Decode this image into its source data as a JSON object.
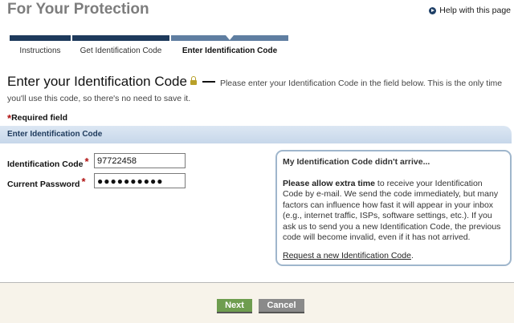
{
  "page": {
    "title": "For Your Protection",
    "help_link": "Help with this page"
  },
  "steps": [
    {
      "label": "Instructions",
      "active": false
    },
    {
      "label": "Get Identification Code",
      "active": false
    },
    {
      "label": "Enter Identification Code",
      "active": true
    }
  ],
  "heading": {
    "title": "Enter your Identification Code",
    "description": "Please enter your Identification Code in the field below. This is the only time you'll use this code, so there's no need to save it."
  },
  "required_note": "Required field",
  "section": {
    "title": "Enter Identification Code"
  },
  "form": {
    "id_code_label": "Identification Code",
    "id_code_value": "97722458",
    "password_label": "Current Password",
    "password_value": "●●●●●●●●●●"
  },
  "info_box": {
    "title": "My Identification Code didn't arrive...",
    "strong_text": "Please allow extra time",
    "body": " to receive your Identification Code by e-mail. We send the code immediately, but many factors can influence how fast it will appear in your inbox (e.g., internet traffic, ISPs, software settings, etc.). If you ask us to send you a new Identification Code, the previous code will become invalid, even if it has not arrived.",
    "link": "Request a new Identification Code"
  },
  "buttons": {
    "next": "Next",
    "cancel": "Cancel"
  }
}
